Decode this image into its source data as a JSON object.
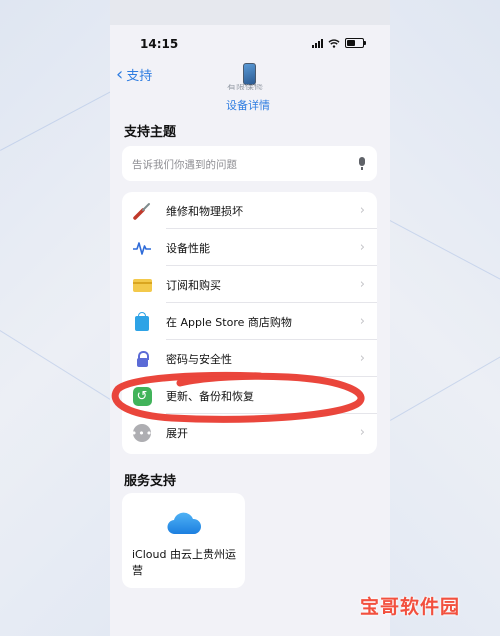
{
  "status_bar": {
    "time": "14:15"
  },
  "nav": {
    "back_label": "支持",
    "device_icon": "iphone-icon"
  },
  "device": {
    "warranty_partial": "有限保修",
    "details_link": "设备详情"
  },
  "topics": {
    "title": "支持主题",
    "search_placeholder": "告诉我们你遇到的问题",
    "items": [
      {
        "label": "维修和物理损坏",
        "icon": "screwdriver-icon"
      },
      {
        "label": "设备性能",
        "icon": "heartbeat-icon"
      },
      {
        "label": "订阅和购买",
        "icon": "credit-card-icon"
      },
      {
        "label": "在 Apple Store 商店购物",
        "icon": "shopping-bag-icon"
      },
      {
        "label": "密码与安全性",
        "icon": "lock-icon"
      },
      {
        "label": "更新、备份和恢复",
        "icon": "restore-icon"
      },
      {
        "label": "展开",
        "icon": "more-icon"
      }
    ]
  },
  "services": {
    "title": "服务支持",
    "card_label": "iCloud 由云上贵州运营",
    "card_icon": "icloud-icon"
  },
  "watermark": "宝哥软件园",
  "colors": {
    "accent": "#2f7de1",
    "annotation": "#e8362b",
    "watermark": "#f2503e"
  }
}
